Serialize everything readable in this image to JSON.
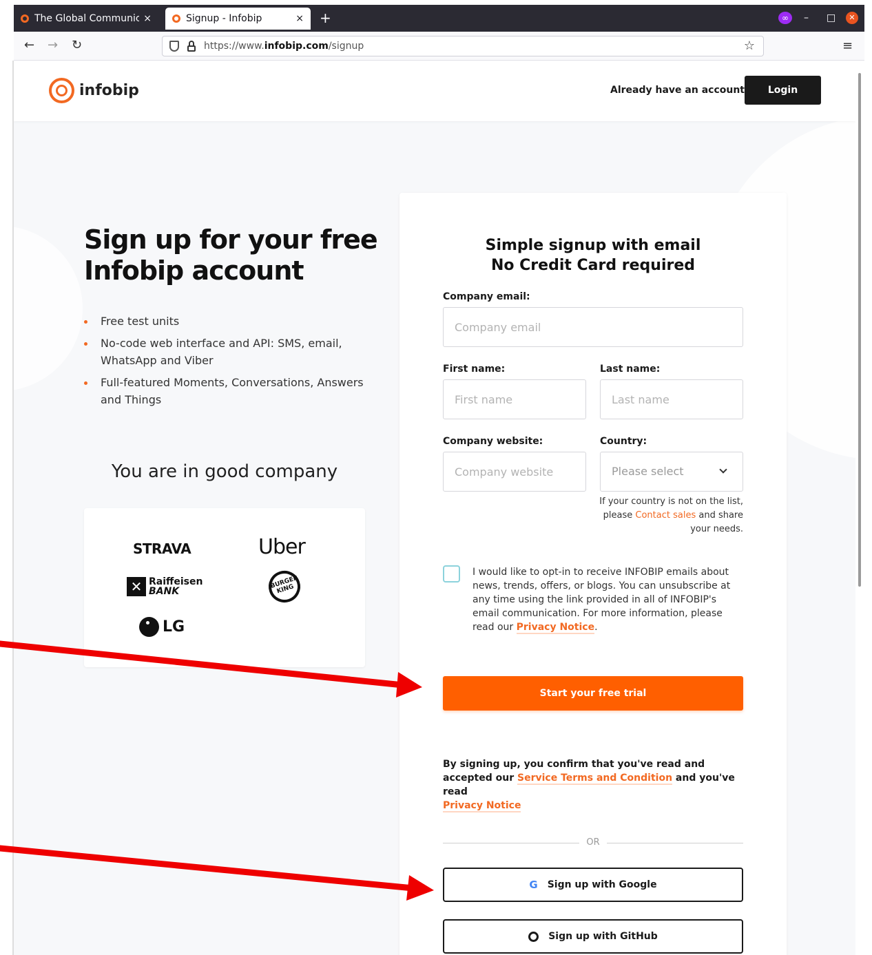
{
  "browser": {
    "tabs": [
      {
        "title": "The Global Communicatio",
        "active": false
      },
      {
        "title": "Signup - Infobip",
        "active": true
      }
    ],
    "close_glyph": "×",
    "new_tab_glyph": "+",
    "url_prefix": "https://www.",
    "url_domain": "infobip.com",
    "url_path": "/signup",
    "icons": {
      "back": "back-arrow-icon",
      "forward": "forward-arrow-icon",
      "reload": "reload-icon",
      "shield": "shield-icon",
      "lock": "lock-icon",
      "bookmark": "star-icon",
      "menu": "hamburger-menu-icon",
      "extension": "private-mask-icon"
    }
  },
  "header": {
    "logo_text": "infobip",
    "have_account": "Already have an account?",
    "login_label": "Login"
  },
  "hero": {
    "title": "Sign up for your free Infobip account",
    "bullets": [
      "Free test units",
      "No-code web interface and API: SMS, email, WhatsApp and Viber",
      "Full-featured Moments, Conversations, Answers and Things"
    ],
    "good_company": "You are in good company",
    "brands": [
      "STRAVA",
      "Uber",
      "Raiffeisen",
      "BANK",
      "BURGER KING",
      "LG"
    ]
  },
  "form": {
    "title_line1": "Simple signup with email",
    "title_line2": "No Credit Card required",
    "company_email_label": "Company email:",
    "company_email_placeholder": "Company email",
    "first_name_label": "First name:",
    "first_name_placeholder": "First name",
    "last_name_label": "Last name:",
    "last_name_placeholder": "Last name",
    "website_label": "Company website:",
    "website_placeholder": "Company website",
    "country_label": "Country:",
    "country_value": "Please select",
    "country_note_pre": "If your country is not on the list, please ",
    "country_note_link": "Contact sales",
    "country_note_post": " and share your needs.",
    "optin_text": "I would like to opt-in to receive INFOBIP emails about news, trends, offers, or blogs. You can unsubscribe at any time using the link provided in all of INFOBIP's email communication. For more information, please read our ",
    "optin_link": "Privacy Notice",
    "optin_end": ".",
    "submit_label": "Start your free trial",
    "terms_pre": "By signing up, you confirm that you've read and accepted our ",
    "terms_link": "Service Terms and Condition",
    "terms_mid": " and you've read ",
    "terms_link2": "Privacy Notice",
    "or_label": "OR",
    "google_label": "Sign up with Google",
    "github_label": "Sign up with GitHub"
  },
  "colors": {
    "accent": "#ff5f00",
    "brand_orange": "#f26922",
    "annotation_red": "#ee0000",
    "dark": "#1a1a1a"
  }
}
